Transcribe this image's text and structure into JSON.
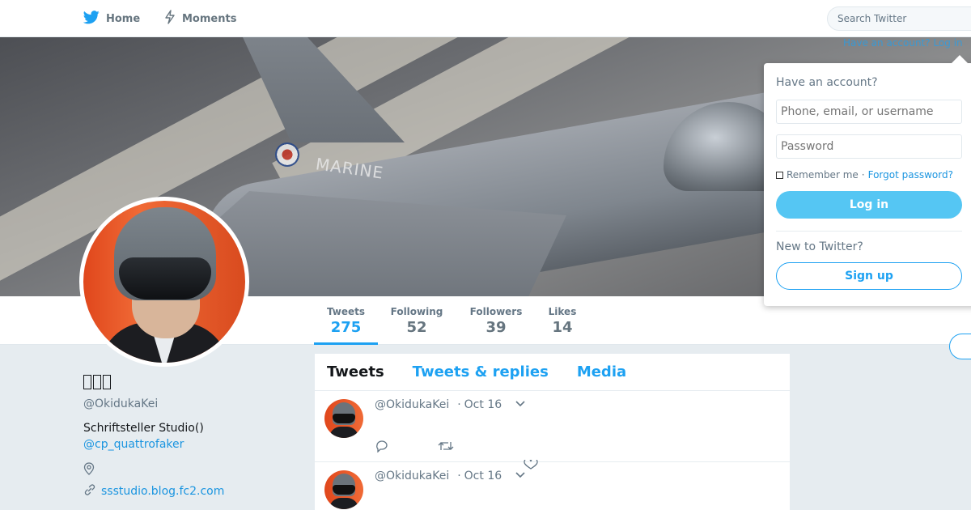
{
  "nav": {
    "home_label": "Home",
    "moments_label": "Moments",
    "search_placeholder": "Search Twitter",
    "brand_color": "#1da1f2"
  },
  "banner": {
    "aircraft_marking": "MARINE",
    "behind_dropdown_text": "Have an account? Log in"
  },
  "profile": {
    "display_name": "",
    "handle": "@OkidukaKei",
    "bio": "Schriftsteller Studio()",
    "bio_link": "@cp_quattrofaker",
    "website": "ssstudio.blog.fc2.com"
  },
  "stats": [
    {
      "label": "Tweets",
      "value": "275"
    },
    {
      "label": "Following",
      "value": "52"
    },
    {
      "label": "Followers",
      "value": "39"
    },
    {
      "label": "Likes",
      "value": "14"
    }
  ],
  "timeline": {
    "tabs": [
      "Tweets",
      "Tweets & replies",
      "Media"
    ],
    "tweets": [
      {
        "handle": "@OkidukaKei",
        "date": "Oct 16"
      },
      {
        "handle": "@OkidukaKei",
        "date": "Oct 16"
      }
    ]
  },
  "login": {
    "title": "Have an account?",
    "username_placeholder": "Phone, email, or username",
    "password_placeholder": "Password",
    "remember_label": "Remember me",
    "separator": "·",
    "forgot_label": "Forgot password?",
    "login_button": "Log in",
    "new_label": "New to Twitter?",
    "signup_button": "Sign up"
  }
}
